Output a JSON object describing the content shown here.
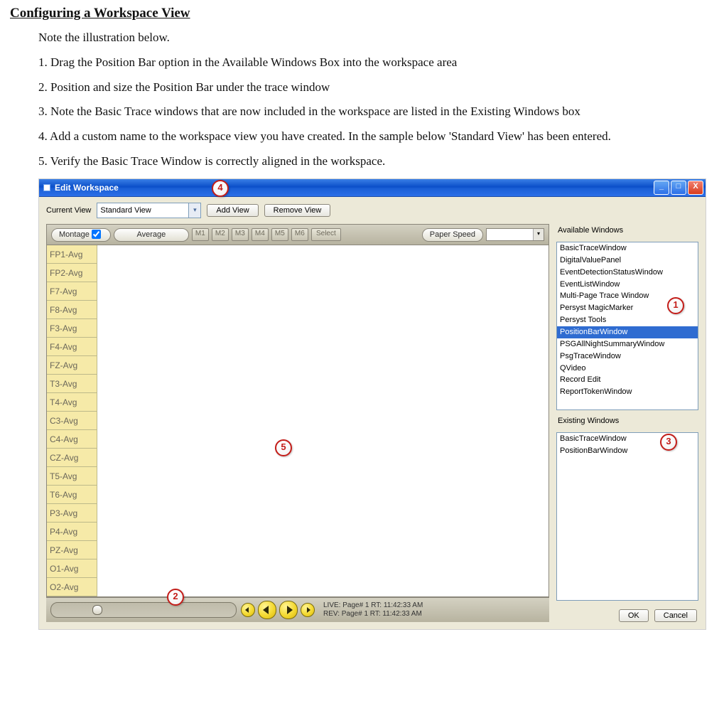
{
  "doc": {
    "heading": "Configuring a Workspace View",
    "intro": "Note the illustration below.",
    "steps": [
      "1.  Drag the Position Bar option in the Available Windows Box into the workspace area",
      "2.  Position and size the Position Bar under the trace window",
      "3.  Note the Basic Trace windows that are now included in the workspace are listed in the Existing Windows box",
      "4.  Add a custom name to the workspace view you have created.  In the sample below 'Standard View' has been entered.",
      "5.  Verify the Basic Trace Window is correctly aligned in the workspace."
    ]
  },
  "window": {
    "title": "Edit Workspace",
    "min_glyph": "_",
    "max_glyph": "□",
    "close_glyph": "X"
  },
  "toprow": {
    "current_view_label": "Current View",
    "current_view_value": "Standard View",
    "add_view_label": "Add View",
    "remove_view_label": "Remove View"
  },
  "tracebar": {
    "montage_label": "Montage",
    "montage_checked": true,
    "montage_select": "Average",
    "m_buttons": [
      "M1",
      "M2",
      "M3",
      "M4",
      "M5",
      "M6",
      "Select"
    ],
    "paper_speed_label": "Paper Speed",
    "paper_speed_value": ""
  },
  "channels": [
    "FP1-Avg",
    "FP2-Avg",
    "F7-Avg",
    "F8-Avg",
    "F3-Avg",
    "F4-Avg",
    "FZ-Avg",
    "T3-Avg",
    "T4-Avg",
    "C3-Avg",
    "C4-Avg",
    "CZ-Avg",
    "T5-Avg",
    "T6-Avg",
    "P3-Avg",
    "P4-Avg",
    "PZ-Avg",
    "O1-Avg",
    "O2-Avg"
  ],
  "posbar": {
    "live_line": "LIVE: Page# 1  RT: 11:42:33 AM",
    "rev_line": "REV: Page# 1  RT: 11:42:33 AM"
  },
  "available": {
    "label": "Available Windows",
    "items": [
      "BasicTraceWindow",
      "DigitalValuePanel",
      "EventDetectionStatusWindow",
      "EventListWindow",
      "Multi-Page Trace Window",
      "Persyst MagicMarker",
      "Persyst Tools",
      "PositionBarWindow",
      "PSGAllNightSummaryWindow",
      "PsgTraceWindow",
      "QVideo",
      "Record Edit",
      "ReportTokenWindow"
    ],
    "selected_index": 7
  },
  "existing": {
    "label": "Existing Windows",
    "items": [
      "BasicTraceWindow",
      "PositionBarWindow"
    ]
  },
  "dialog": {
    "ok": "OK",
    "cancel": "Cancel"
  },
  "callouts": {
    "c1": "1",
    "c2": "2",
    "c3": "3",
    "c4": "4",
    "c5": "5"
  }
}
